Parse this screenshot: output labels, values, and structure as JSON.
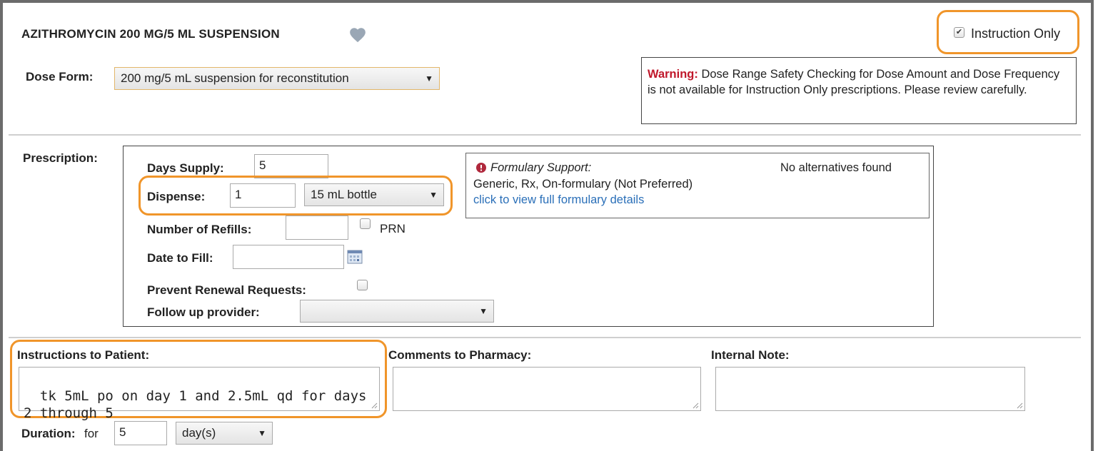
{
  "drug": {
    "title": "AZITHROMYCIN 200 MG/5 ML SUSPENSION",
    "favorite_icon": "heart-icon"
  },
  "instruction_only": {
    "label": "Instruction Only",
    "checked": true
  },
  "dose_form": {
    "label": "Dose Form:",
    "value": "200 mg/5 mL suspension for reconstitution"
  },
  "warning": {
    "prefix": "Warning:",
    "text": "Dose Range Safety Checking for Dose Amount and Dose Frequency is not available for Instruction Only prescriptions. Please review carefully."
  },
  "prescription": {
    "label": "Prescription:",
    "days_supply": {
      "label": "Days Supply:",
      "value": "5"
    },
    "dispense": {
      "label": "Dispense:",
      "quantity": "1",
      "unit": "15 mL bottle"
    },
    "refills": {
      "label": "Number of Refills:",
      "value": "",
      "prn_label": "PRN"
    },
    "date_to_fill": {
      "label": "Date to Fill:",
      "value": ""
    },
    "prevent_renewal": {
      "label": "Prevent Renewal Requests:"
    },
    "follow_up": {
      "label": "Follow up provider:",
      "value": ""
    }
  },
  "formulary": {
    "title": "Formulary Support:",
    "status": "Generic, Rx, On-formulary (Not Preferred)",
    "link": "click to view full formulary details",
    "alternatives": "No alternatives found"
  },
  "notes": {
    "instructions_label": "Instructions to Patient:",
    "instructions_value": "tk 5mL po on day 1 and 2.5mL qd for days 2 through 5",
    "comments_label": "Comments to Pharmacy:",
    "comments_value": "",
    "internal_label": "Internal Note:",
    "internal_value": ""
  },
  "duration": {
    "label": "Duration:",
    "for": "for",
    "value": "5",
    "unit": "day(s)"
  },
  "colors": {
    "highlight": "#f0952a",
    "warning": "#c0182b",
    "link": "#2a6fb8"
  }
}
